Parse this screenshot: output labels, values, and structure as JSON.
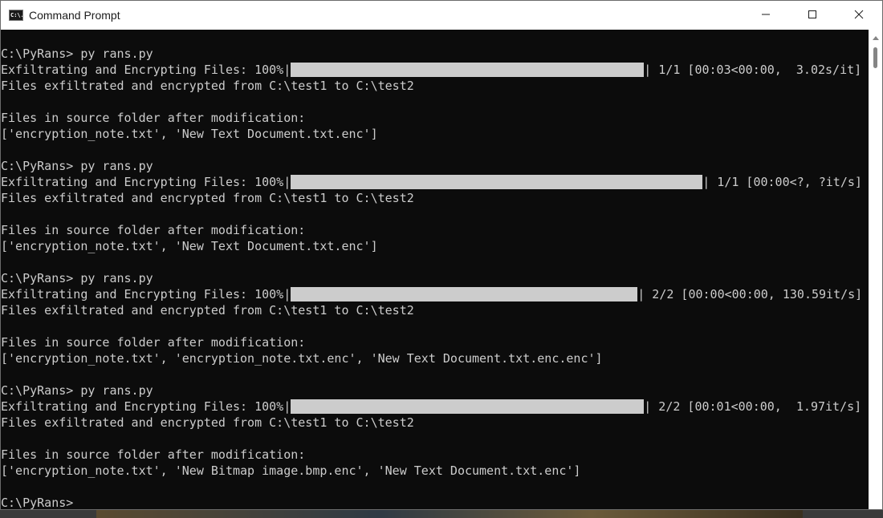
{
  "window": {
    "title": "Command Prompt",
    "icon": "cmd-icon",
    "icon_text": "C:\\.",
    "controls": [
      "minimize-icon",
      "maximize-icon",
      "close-icon"
    ]
  },
  "terminal": {
    "lines": [
      {
        "type": "text",
        "text": "C:\\PyRans> py rans.py"
      },
      {
        "type": "progress",
        "prefix": "Exfiltrating and Encrypting Files: 100%|",
        "progress": 1.0,
        "suffix": "| 1/1 [00:03<00:00,  3.02s/it]"
      },
      {
        "type": "text",
        "text": "Files exfiltrated and encrypted from C:\\test1 to C:\\test2"
      },
      {
        "type": "text",
        "text": ""
      },
      {
        "type": "text",
        "text": "Files in source folder after modification:"
      },
      {
        "type": "text",
        "text": "['encryption_note.txt', 'New Text Document.txt.enc']"
      },
      {
        "type": "text",
        "text": ""
      },
      {
        "type": "text",
        "text": "C:\\PyRans> py rans.py"
      },
      {
        "type": "progress",
        "prefix": "Exfiltrating and Encrypting Files: 100%|",
        "progress": 1.0,
        "suffix": "| 1/1 [00:00<?, ?it/s]"
      },
      {
        "type": "text",
        "text": "Files exfiltrated and encrypted from C:\\test1 to C:\\test2"
      },
      {
        "type": "text",
        "text": ""
      },
      {
        "type": "text",
        "text": "Files in source folder after modification:"
      },
      {
        "type": "text",
        "text": "['encryption_note.txt', 'New Text Document.txt.enc']"
      },
      {
        "type": "text",
        "text": ""
      },
      {
        "type": "text",
        "text": "C:\\PyRans> py rans.py"
      },
      {
        "type": "progress",
        "prefix": "Exfiltrating and Encrypting Files: 100%|",
        "progress": 1.0,
        "suffix": "| 2/2 [00:00<00:00, 130.59it/s]"
      },
      {
        "type": "text",
        "text": "Files exfiltrated and encrypted from C:\\test1 to C:\\test2"
      },
      {
        "type": "text",
        "text": ""
      },
      {
        "type": "text",
        "text": "Files in source folder after modification:"
      },
      {
        "type": "text",
        "text": "['encryption_note.txt', 'encryption_note.txt.enc', 'New Text Document.txt.enc.enc']"
      },
      {
        "type": "text",
        "text": ""
      },
      {
        "type": "text",
        "text": "C:\\PyRans> py rans.py"
      },
      {
        "type": "progress",
        "prefix": "Exfiltrating and Encrypting Files: 100%|",
        "progress": 1.0,
        "suffix": "| 2/2 [00:01<00:00,  1.97it/s]"
      },
      {
        "type": "text",
        "text": "Files exfiltrated and encrypted from C:\\test1 to C:\\test2"
      },
      {
        "type": "text",
        "text": ""
      },
      {
        "type": "text",
        "text": "Files in source folder after modification:"
      },
      {
        "type": "text",
        "text": "['encryption_note.txt', 'New Bitmap image.bmp.enc', 'New Text Document.txt.enc']"
      },
      {
        "type": "text",
        "text": ""
      },
      {
        "type": "text",
        "text": "C:\\PyRans>"
      }
    ]
  },
  "colors": {
    "terminal_bg": "#0c0c0c",
    "terminal_fg": "#cccccc",
    "progress_fill": "#cccccc",
    "titlebar_bg": "#ffffff"
  }
}
